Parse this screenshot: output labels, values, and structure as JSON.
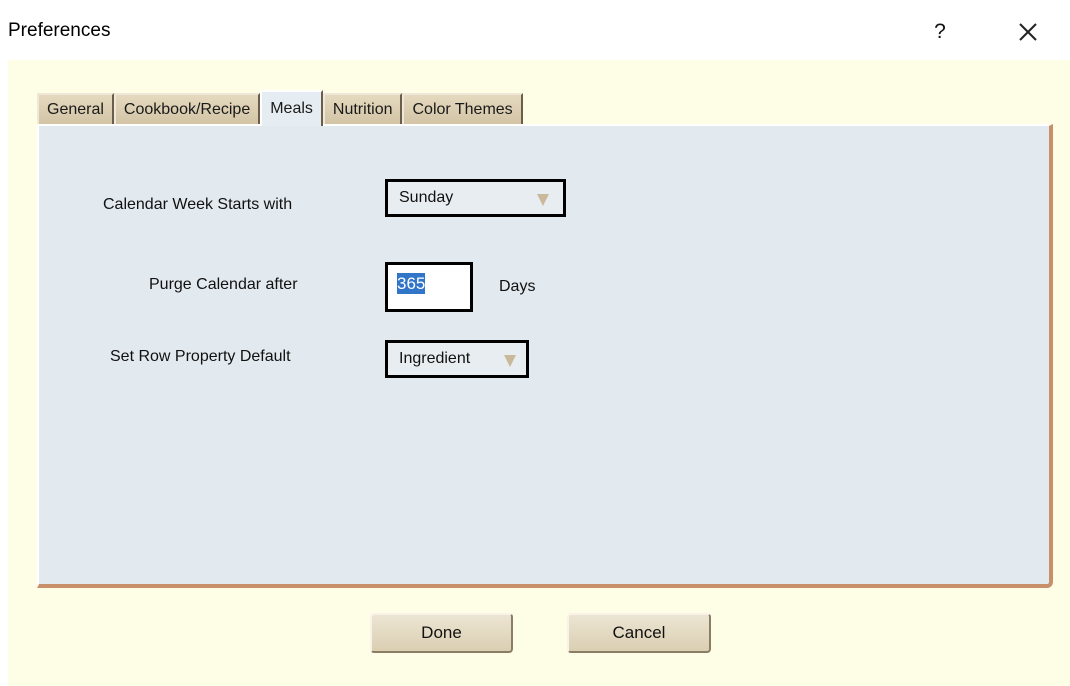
{
  "window": {
    "title": "Preferences",
    "help_label": "?",
    "close_icon": "close-icon"
  },
  "tabs": [
    {
      "label": "General",
      "active": false
    },
    {
      "label": "Cookbook/Recipe",
      "active": false
    },
    {
      "label": "Meals",
      "active": true
    },
    {
      "label": "Nutrition",
      "active": false
    },
    {
      "label": "Color Themes",
      "active": false
    }
  ],
  "meals": {
    "week_start": {
      "label": "Calendar Week Starts with",
      "value": "Sunday"
    },
    "purge": {
      "label": "Purge Calendar after",
      "value": "365",
      "unit": "Days"
    },
    "row_property": {
      "label": "Set Row Property Default",
      "value": "Ingredient"
    }
  },
  "buttons": {
    "done": "Done",
    "cancel": "Cancel"
  },
  "colors": {
    "window_bg": "#fefde6",
    "panel_bg": "#e2e9ef",
    "panel_border_accent": "#c8906a",
    "tab_bg": "#d9cbb0",
    "selection": "#3175c9"
  }
}
